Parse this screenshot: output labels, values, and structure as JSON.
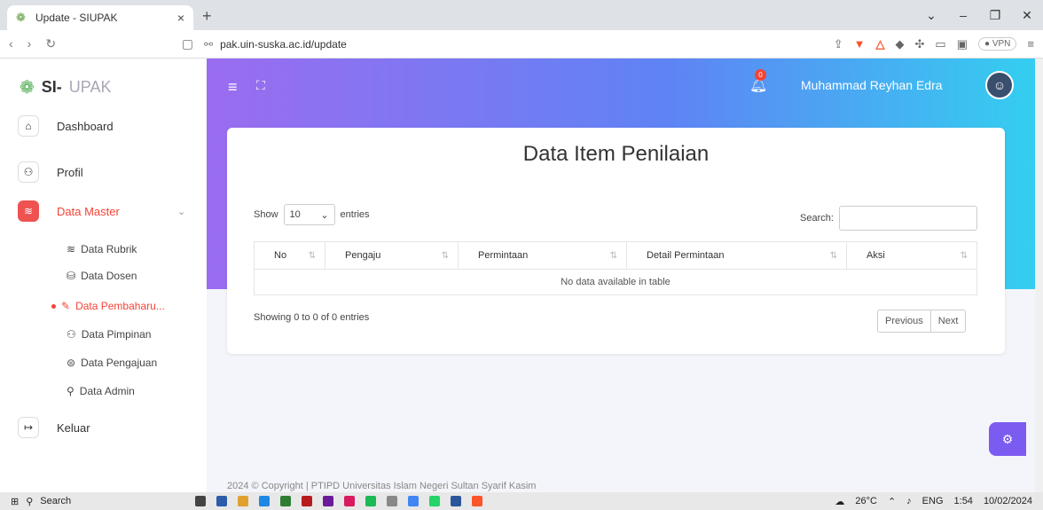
{
  "browser": {
    "tab_title": "Update - SIUPAK",
    "url": "pak.uin-suska.ac.id/update",
    "vpn_label": "VPN"
  },
  "sidebar": {
    "brand_prefix": "SI-",
    "brand_suffix": "UPAK",
    "items": [
      {
        "label": "Dashboard",
        "icon": "home-icon"
      },
      {
        "label": "Profil",
        "icon": "user-icon"
      },
      {
        "label": "Data Master",
        "icon": "layers-icon"
      },
      {
        "label": "Keluar",
        "icon": "logout-icon"
      }
    ],
    "sub_items": [
      {
        "label": "Data Rubrik"
      },
      {
        "label": "Data Dosen"
      },
      {
        "label": "Data Pembaharu..."
      },
      {
        "label": "Data Pimpinan"
      },
      {
        "label": "Data Pengajuan"
      },
      {
        "label": "Data Admin"
      }
    ]
  },
  "header": {
    "notif_count": "0",
    "user_name": "Muhammad Reyhan Edra"
  },
  "card": {
    "title": "Data Item Penilaian",
    "show_label": "Show",
    "entries_value": "10",
    "entries_label": "entries",
    "search_label": "Search:",
    "columns": [
      "No",
      "Pengaju",
      "Permintaan",
      "Detail Permintaan",
      "Aksi"
    ],
    "empty_text": "No data available in table",
    "info": "Showing 0 to 0 of 0 entries",
    "prev": "Previous",
    "next": "Next"
  },
  "footer": {
    "text": "2024 © Copyright | PTIPD Universitas Islam Negeri Sultan Syarif Kasim"
  },
  "taskbar": {
    "search": "Search",
    "weather": "26°C",
    "lang": "ENG",
    "time": "1:54",
    "date": "10/02/2024"
  },
  "colors": {
    "accent": "#f44336",
    "gradient_start": "#9b6cf0",
    "gradient_end": "#33d0f0"
  }
}
